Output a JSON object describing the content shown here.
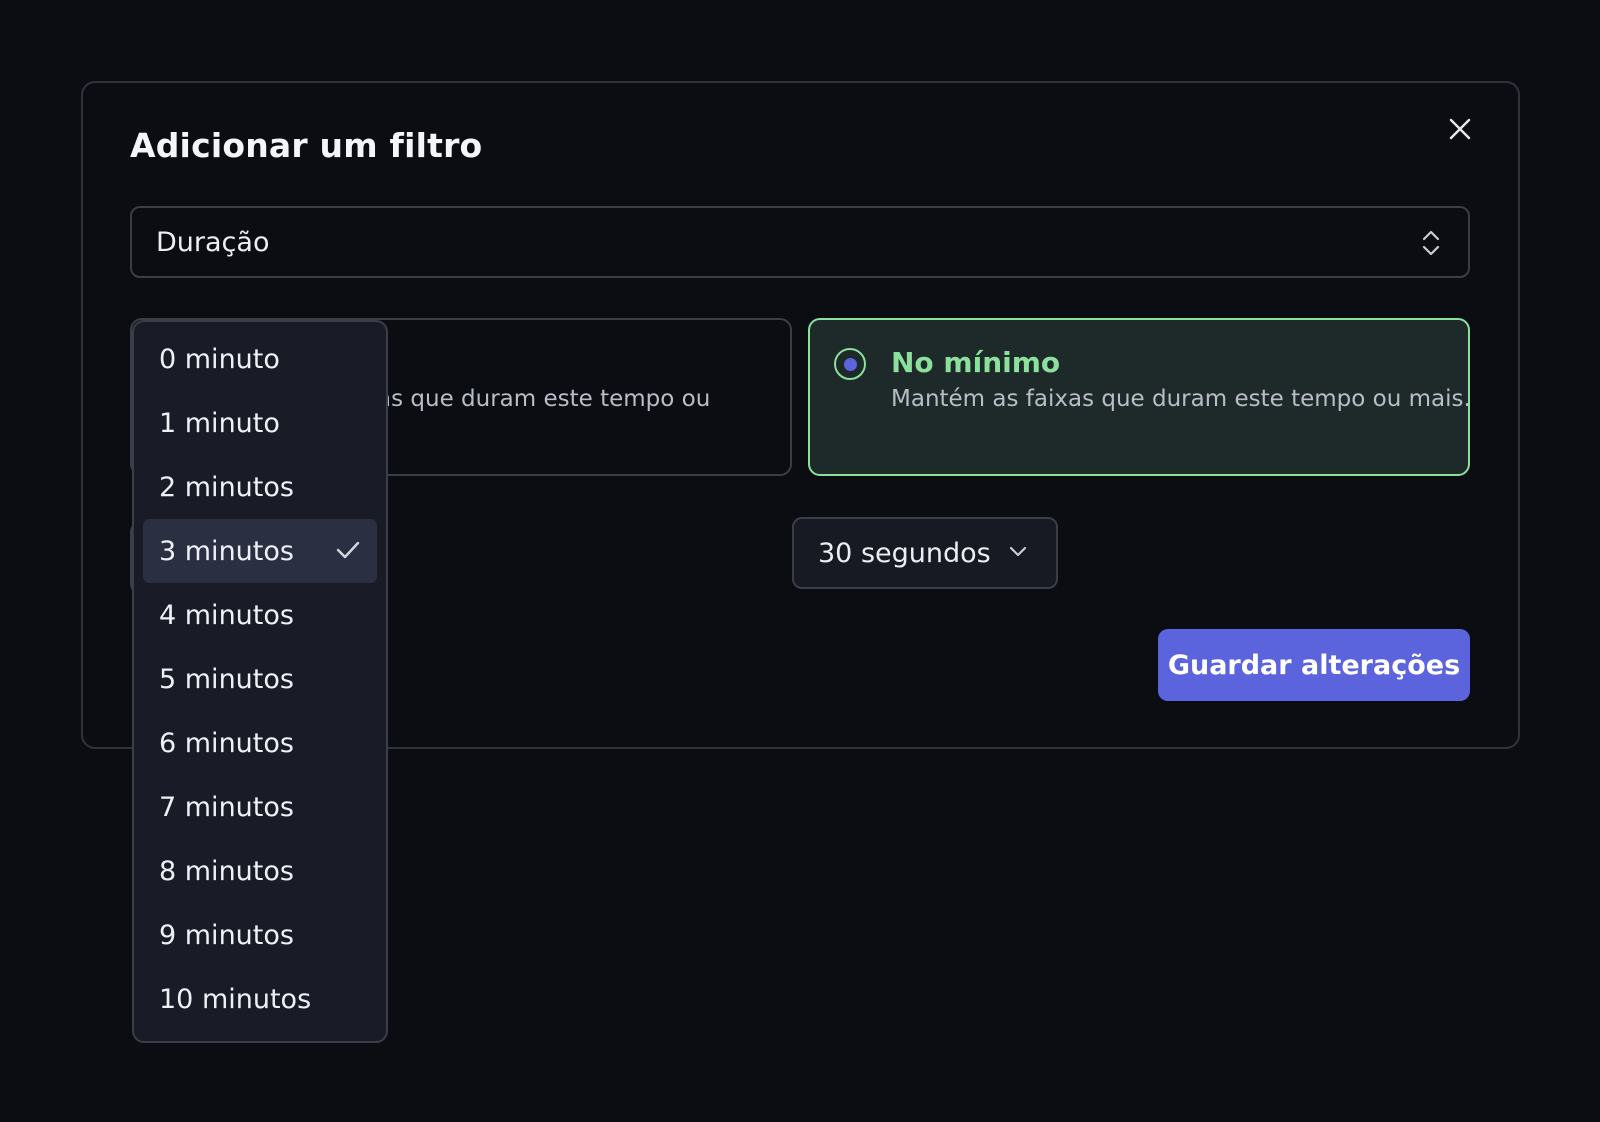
{
  "dialog": {
    "title": "Adicionar um filtro",
    "close_icon": "close-icon"
  },
  "filter_type": {
    "value": "Duração",
    "icon": "chevron-up-down-icon"
  },
  "options": {
    "left": {
      "description_partial": "as que duram este tempo ou"
    },
    "right": {
      "title": "No mínimo",
      "description": "Mantém as faixas que duram este tempo ou mais.",
      "selected": true
    }
  },
  "seconds_select": {
    "value": "30 segundos",
    "icon": "chevron-down-icon"
  },
  "save_button": {
    "label": "Guardar alterações"
  },
  "minutes_dropdown": {
    "items": [
      {
        "label": "0 minuto"
      },
      {
        "label": "1 minuto"
      },
      {
        "label": "2 minutos"
      },
      {
        "label": "3 minutos",
        "selected": true
      },
      {
        "label": "4 minutos"
      },
      {
        "label": "5 minutos"
      },
      {
        "label": "6 minutos"
      },
      {
        "label": "7 minutos"
      },
      {
        "label": "8 minutos"
      },
      {
        "label": "9 minutos"
      },
      {
        "label": "10 minutos"
      }
    ]
  },
  "colors": {
    "background": "#0b0d12",
    "accent": "#5b63dd",
    "success": "#8be09b",
    "selected_card_bg": "#1e2a2a",
    "dropdown_bg": "#191c26"
  }
}
